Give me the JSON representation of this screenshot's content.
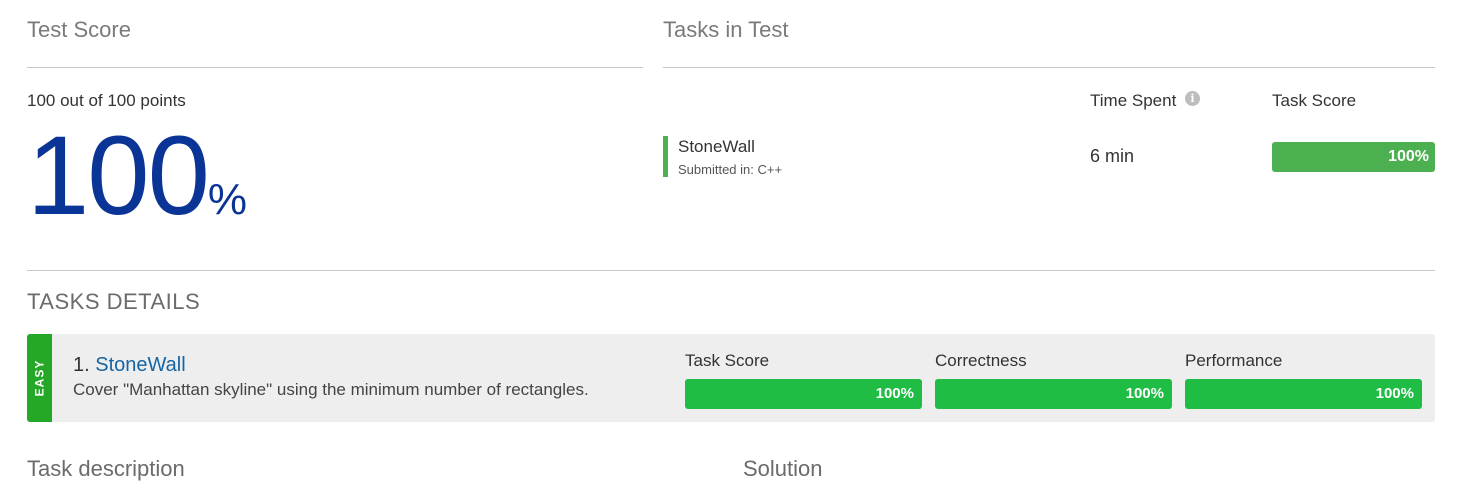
{
  "test_score": {
    "title": "Test Score",
    "summary": "100 out of 100 points",
    "percent_value": "100",
    "percent_sign": "%"
  },
  "tasks_in_test": {
    "title": "Tasks in Test",
    "headers": {
      "time_spent": "Time Spent",
      "task_score": "Task Score"
    },
    "info_glyph": "i",
    "tasks": [
      {
        "name": "StoneWall",
        "submitted": "Submitted in: C++",
        "time_spent": "6 min",
        "score_label": "100%",
        "score_fraction": 1.0
      }
    ]
  },
  "tasks_details": {
    "title": "TASKS DETAILS",
    "items": [
      {
        "difficulty": "EASY",
        "number": "1.",
        "name": "StoneWall",
        "description": "Cover \"Manhattan skyline\" using the minimum number of rectangles.",
        "metrics": [
          {
            "label": "Task Score",
            "value": "100%",
            "fraction": 1.0
          },
          {
            "label": "Correctness",
            "value": "100%",
            "fraction": 1.0
          },
          {
            "label": "Performance",
            "value": "100%",
            "fraction": 1.0
          }
        ]
      }
    ]
  },
  "bottom": {
    "left_label": "Task description",
    "right_label": "Solution"
  },
  "colors": {
    "percent_blue": "#0a3596",
    "score_green": "#4caf50",
    "metric_green": "#20bd45",
    "easy_green": "#25a828",
    "link_blue": "#1565a5"
  },
  "icons": {
    "info": "info-icon"
  }
}
